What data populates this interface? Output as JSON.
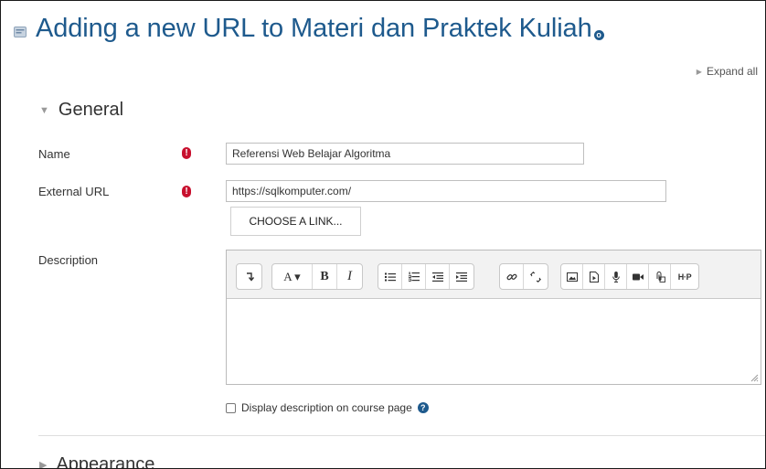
{
  "page": {
    "title": "Adding a new URL to Materi dan Praktek Kuliah"
  },
  "expand_all": {
    "label": "Expand all"
  },
  "sections": {
    "general": "General",
    "appearance": "Appearance"
  },
  "form": {
    "name": {
      "label": "Name",
      "value": "Referensi Web Belajar Algoritma"
    },
    "external_url": {
      "label": "External URL",
      "value": "https://sqlkomputer.com/"
    },
    "choose_link": {
      "label": "CHOOSE A LINK..."
    },
    "description": {
      "label": "Description",
      "value": ""
    },
    "display_description": {
      "label": "Display description on course page",
      "checked": false
    }
  },
  "toolbar_groups": [
    [
      "toggle-more"
    ],
    [
      "font-style",
      "bold",
      "italic"
    ],
    [
      "unordered-list",
      "ordered-list",
      "outdent",
      "indent"
    ],
    [
      "link",
      "unlink"
    ],
    [
      "image",
      "media",
      "record-audio",
      "record-video",
      "manage-files",
      "h5p"
    ]
  ],
  "toolbar_glyphs": {
    "font-style": "A ▾",
    "bold": "B",
    "italic": "I",
    "h5p": "H·P"
  },
  "colors": {
    "title": "#1e5a8d",
    "required": "#c8102e",
    "help": "#1e5a8d",
    "toolbar_bg": "#f2f2f2"
  }
}
